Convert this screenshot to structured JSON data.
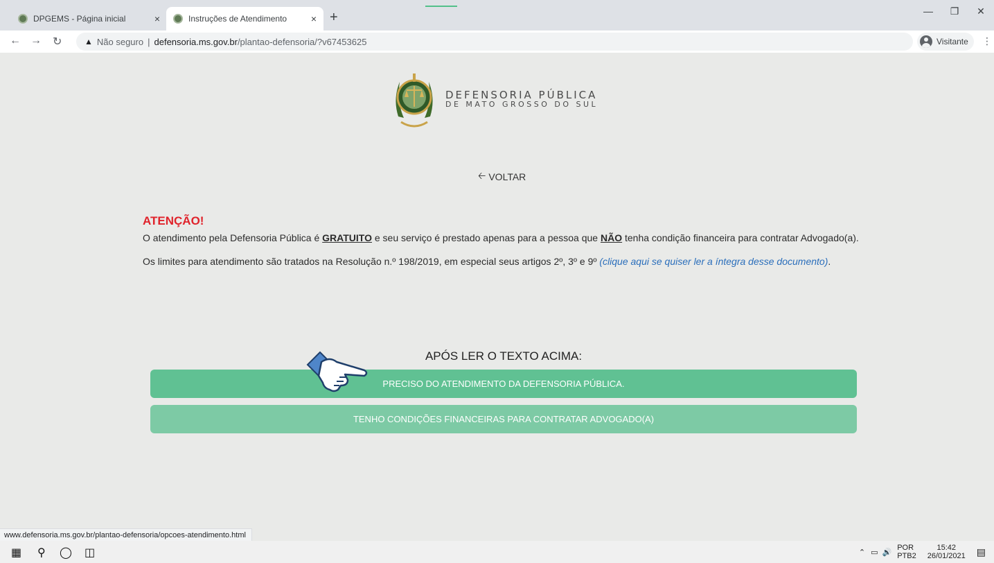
{
  "browser": {
    "tabs": [
      {
        "title": "DPGEMS - Página inicial",
        "active": false
      },
      {
        "title": "Instruções de Atendimento",
        "active": true
      }
    ],
    "new_tab_symbol": "+",
    "close_symbol": "×",
    "address": {
      "security_label": "Não seguro",
      "domain": "defensoria.ms.gov.br",
      "path": "/plantao-defensoria/?v67453625"
    },
    "profile_label": "Visitante",
    "status_url": "www.defensoria.ms.gov.br/plantao-defensoria/opcoes-atendimento.html"
  },
  "logo": {
    "line1": "DEFENSORIA PÚBLICA",
    "line2": "DE MATO GROSSO DO SUL"
  },
  "back_label": "VOLTAR",
  "notice": {
    "heading": "ATENÇÃO!",
    "p1_a": "O atendimento pela Defensoria Pública é ",
    "p1_free": "GRATUITO",
    "p1_b": " e seu serviço é prestado apenas para a pessoa que ",
    "p1_not": "NÃO",
    "p1_c": " tenha condição financeira para contratar Advogado(a).",
    "p2_a": "Os limites para atendimento são tratados na Resolução n.º 198/2019, em especial seus artigos 2º, 3º e 9º ",
    "p2_link": "(clique aqui se quiser ler a íntegra desse documento)",
    "p2_b": "."
  },
  "after_heading": "APÓS LER O TEXTO ACIMA:",
  "buttons": {
    "need": "PRECISO DO ATENDIMENTO DA DEFENSORIA PÚBLICA.",
    "afford": "TENHO CONDIÇÕES FINANCEIRAS PARA CONTRATAR ADVOGADO(A)"
  },
  "taskbar": {
    "lang_top": "POR",
    "lang_bottom": "PTB2",
    "time": "15:42",
    "date": "26/01/2021"
  },
  "colors": {
    "attention": "#e0232b",
    "primary_button": "#60c193",
    "secondary_button": "#7dcaa5",
    "link": "#2a6ebb"
  }
}
